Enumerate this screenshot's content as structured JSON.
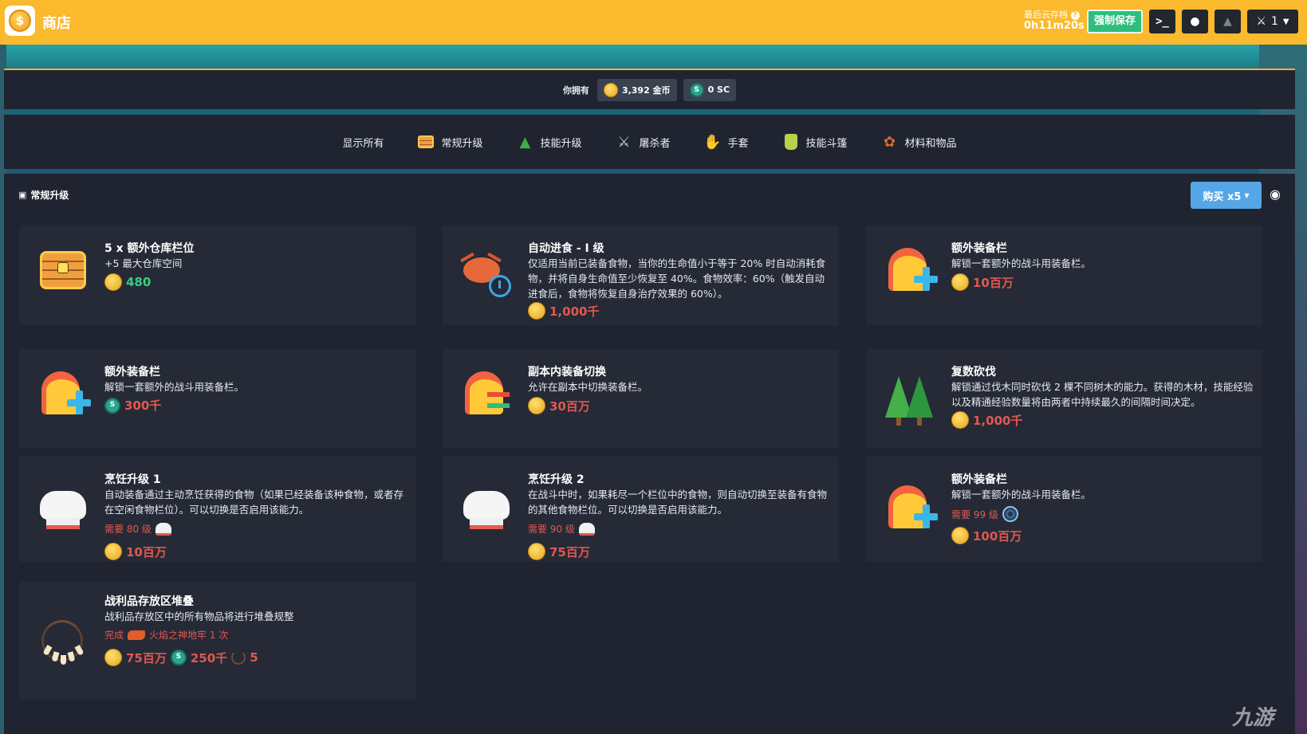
{
  "header": {
    "title": "商店",
    "save_label": "最后云存档",
    "save_time": "0h11m20s",
    "force_save": "强制保存",
    "user_count": "1",
    "colors": {
      "bar": "#fbb92e",
      "force_save": "#2ebd7d"
    }
  },
  "currency": {
    "own_label": "你拥有",
    "gold": "3,392 金币",
    "sc": "0 SC"
  },
  "tabs": [
    {
      "label": "显示所有",
      "icon": ""
    },
    {
      "label": "常规升级",
      "icon": "chest-icon"
    },
    {
      "label": "技能升级",
      "icon": "tree-icon"
    },
    {
      "label": "屠杀者",
      "icon": "slayer-icon"
    },
    {
      "label": "手套",
      "icon": "glove-icon"
    },
    {
      "label": "技能斗篷",
      "icon": "cape-icon"
    },
    {
      "label": "材料和物品",
      "icon": "leaf-icon"
    }
  ],
  "section": {
    "title": "常规升级",
    "buy_label": "购买 x5"
  },
  "cards": [
    {
      "title": "5 x 额外仓库栏位",
      "desc": "+5 最大仓库空间",
      "price": "480"
    },
    {
      "title": "自动进食 - I 级",
      "desc": "仅适用当前已装备食物，当你的生命值小于等于 20% 时自动消耗食物，并将自身生命值至少恢复至 40%。食物效率：60%（触发自动进食后，食物将恢复自身治疗效果的 60%）。",
      "price": "1,000千"
    },
    {
      "title": "额外装备栏",
      "desc": "解锁一套额外的战斗用装备栏。",
      "price": "10百万"
    },
    {
      "title": "额外装备栏",
      "desc": "解锁一套额外的战斗用装备栏。",
      "price": "300千"
    },
    {
      "title": "副本内装备切换",
      "desc": "允许在副本中切换装备栏。",
      "price": "30百万"
    },
    {
      "title": "复数砍伐",
      "desc": "解锁通过伐木同时砍伐 2 棵不同树木的能力。获得的木材，技能经验以及精通经验数量将由两者中持续最久的间隔时间决定。",
      "price": "1,000千"
    },
    {
      "title": "烹饪升级 1",
      "desc": "自动装备通过主动烹饪获得的食物（如果已经装备该种食物，或者存在空闲食物栏位）。可以切换是否启用该能力。",
      "req": "需要 80 级",
      "price": "10百万"
    },
    {
      "title": "烹饪升级 2",
      "desc": "在战斗中时，如果耗尽一个栏位中的食物，则自动切换至装备有食物的其他食物栏位。可以切换是否启用该能力。",
      "req": "需要 90 级",
      "price": "75百万"
    },
    {
      "title": "额外装备栏",
      "desc": "解锁一套额外的战斗用装备栏。",
      "req": "需要 99 级",
      "price": "100百万"
    },
    {
      "title": "战利品存放区堆叠",
      "desc": "战利品存放区中的所有物品将进行堆叠规整",
      "req_prefix": "完成",
      "req": "火焰之神地牢 1 次",
      "price": "75百万",
      "price_sc": "250千",
      "price_item": "5"
    }
  ],
  "watermark": "九游"
}
